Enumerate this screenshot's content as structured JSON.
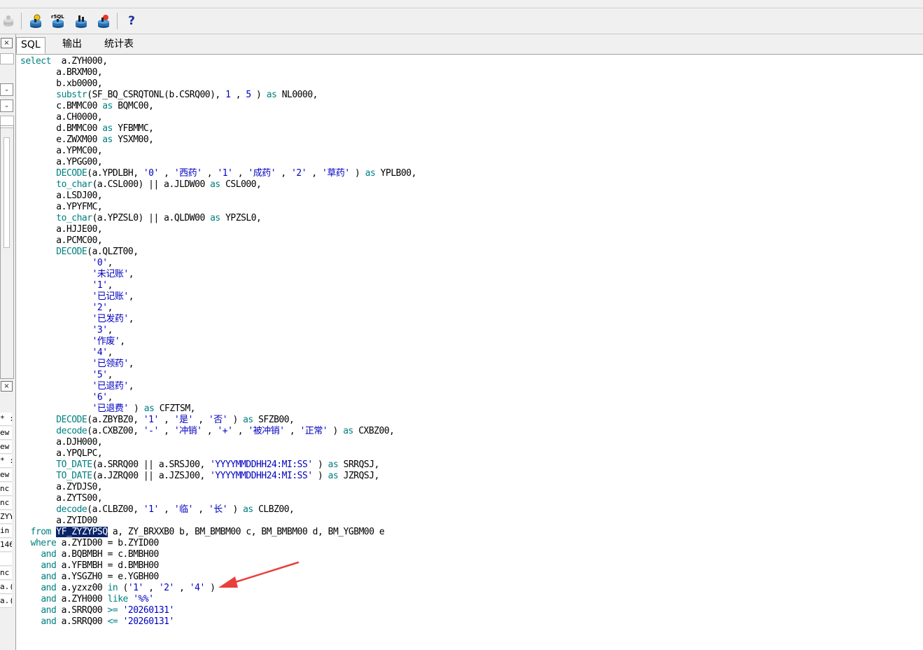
{
  "toolbar": {
    "buttons": [
      "db-disconnect-icon",
      "connect-db-icon",
      "sql-run-icon",
      "db-export-icon",
      "db-commit-icon",
      "help-icon"
    ],
    "help_label": "?"
  },
  "left_pane": {
    "close_label": "×",
    "close2_label": "×",
    "list_items": [
      "* :",
      "ew",
      "ew",
      "* :",
      "ew",
      "nc",
      "nc",
      "ZYY",
      "in",
      "146",
      "",
      "nc",
      "a.(",
      "a.("
    ]
  },
  "tabs": [
    {
      "label": "SQL",
      "active": true
    },
    {
      "label": "输出",
      "active": false
    },
    {
      "label": "统计表",
      "active": false
    }
  ],
  "sql_lines": [
    [
      [
        "kw",
        "select"
      ],
      [
        "",
        "  a.ZYH000,"
      ]
    ],
    [
      [
        "",
        "       a.BRXM00,"
      ]
    ],
    [
      [
        "",
        "       b.xb0000,"
      ]
    ],
    [
      [
        "",
        "       "
      ],
      [
        "fn",
        "substr"
      ],
      [
        "",
        "(SF_BQ_CSRQTONL(b.CSRQ00), "
      ],
      [
        "st",
        "1"
      ],
      [
        "",
        " , "
      ],
      [
        "st",
        "5"
      ],
      [
        "",
        " ) "
      ],
      [
        "kw",
        "as"
      ],
      [
        "",
        " NL0000,"
      ]
    ],
    [
      [
        "",
        "       c.BMMC00 "
      ],
      [
        "kw",
        "as"
      ],
      [
        "",
        " BQMC00,"
      ]
    ],
    [
      [
        "",
        "       a.CH0000,"
      ]
    ],
    [
      [
        "",
        "       d.BMMC00 "
      ],
      [
        "kw",
        "as"
      ],
      [
        "",
        " YFBMMC,"
      ]
    ],
    [
      [
        "",
        "       e.ZWXM00 "
      ],
      [
        "kw",
        "as"
      ],
      [
        "",
        " YSXM00,"
      ]
    ],
    [
      [
        "",
        "       a.YPMC00,"
      ]
    ],
    [
      [
        "",
        "       a.YPGG00,"
      ]
    ],
    [
      [
        "",
        "       "
      ],
      [
        "fn",
        "DECODE"
      ],
      [
        "",
        "(a.YPDLBH, "
      ],
      [
        "st",
        "'0'"
      ],
      [
        "",
        " , "
      ],
      [
        "st",
        "'西药'"
      ],
      [
        "",
        " , "
      ],
      [
        "st",
        "'1'"
      ],
      [
        "",
        " , "
      ],
      [
        "st",
        "'成药'"
      ],
      [
        "",
        " , "
      ],
      [
        "st",
        "'2'"
      ],
      [
        "",
        " , "
      ],
      [
        "st",
        "'草药'"
      ],
      [
        "",
        " ) "
      ],
      [
        "kw",
        "as"
      ],
      [
        "",
        " YPLB00,"
      ]
    ],
    [
      [
        "",
        "       "
      ],
      [
        "fn",
        "to_char"
      ],
      [
        "",
        "(a.CSL000) || a.JLDW00 "
      ],
      [
        "kw",
        "as"
      ],
      [
        "",
        " CSL000,"
      ]
    ],
    [
      [
        "",
        "       a.LSDJ00,"
      ]
    ],
    [
      [
        "",
        "       a.YPYFMC,"
      ]
    ],
    [
      [
        "",
        "       "
      ],
      [
        "fn",
        "to_char"
      ],
      [
        "",
        "(a.YPZSL0) || a.QLDW00 "
      ],
      [
        "kw",
        "as"
      ],
      [
        "",
        " YPZSL0,"
      ]
    ],
    [
      [
        "",
        "       a.HJJE00,"
      ]
    ],
    [
      [
        "",
        "       a.PCMC00,"
      ]
    ],
    [
      [
        "",
        "       "
      ],
      [
        "fn",
        "DECODE"
      ],
      [
        "",
        "(a.QLZT00,"
      ]
    ],
    [
      [
        "",
        "              "
      ],
      [
        "st",
        "'0'"
      ],
      [
        "",
        ","
      ]
    ],
    [
      [
        "",
        "              "
      ],
      [
        "st",
        "'未记账'"
      ],
      [
        "",
        ","
      ]
    ],
    [
      [
        "",
        "              "
      ],
      [
        "st",
        "'1'"
      ],
      [
        "",
        ","
      ]
    ],
    [
      [
        "",
        "              "
      ],
      [
        "st",
        "'已记账'"
      ],
      [
        "",
        ","
      ]
    ],
    [
      [
        "",
        "              "
      ],
      [
        "st",
        "'2'"
      ],
      [
        "",
        ","
      ]
    ],
    [
      [
        "",
        "              "
      ],
      [
        "st",
        "'已发药'"
      ],
      [
        "",
        ","
      ]
    ],
    [
      [
        "",
        "              "
      ],
      [
        "st",
        "'3'"
      ],
      [
        "",
        ","
      ]
    ],
    [
      [
        "",
        "              "
      ],
      [
        "st",
        "'作废'"
      ],
      [
        "",
        ","
      ]
    ],
    [
      [
        "",
        "              "
      ],
      [
        "st",
        "'4'"
      ],
      [
        "",
        ","
      ]
    ],
    [
      [
        "",
        "              "
      ],
      [
        "st",
        "'已领药'"
      ],
      [
        "",
        ","
      ]
    ],
    [
      [
        "",
        "              "
      ],
      [
        "st",
        "'5'"
      ],
      [
        "",
        ","
      ]
    ],
    [
      [
        "",
        "              "
      ],
      [
        "st",
        "'已退药'"
      ],
      [
        "",
        ","
      ]
    ],
    [
      [
        "",
        "              "
      ],
      [
        "st",
        "'6'"
      ],
      [
        "",
        ","
      ]
    ],
    [
      [
        "",
        "              "
      ],
      [
        "st",
        "'已退费'"
      ],
      [
        "",
        " ) "
      ],
      [
        "kw",
        "as"
      ],
      [
        "",
        " CFZTSM,"
      ]
    ],
    [
      [
        "",
        "       "
      ],
      [
        "fn",
        "DECODE"
      ],
      [
        "",
        "(a.ZBYBZ0, "
      ],
      [
        "st",
        "'1'"
      ],
      [
        "",
        " , "
      ],
      [
        "st",
        "'是'"
      ],
      [
        "",
        " , "
      ],
      [
        "st",
        "'否'"
      ],
      [
        "",
        " ) "
      ],
      [
        "kw",
        "as"
      ],
      [
        "",
        " SFZB00,"
      ]
    ],
    [
      [
        "",
        "       "
      ],
      [
        "fn",
        "decode"
      ],
      [
        "",
        "(a.CXBZ00, "
      ],
      [
        "st",
        "'-'"
      ],
      [
        "",
        " , "
      ],
      [
        "st",
        "'冲销'"
      ],
      [
        "",
        " , "
      ],
      [
        "st",
        "'+'"
      ],
      [
        "",
        " , "
      ],
      [
        "st",
        "'被冲销'"
      ],
      [
        "",
        " , "
      ],
      [
        "st",
        "'正常'"
      ],
      [
        "",
        " ) "
      ],
      [
        "kw",
        "as"
      ],
      [
        "",
        " CXBZ00,"
      ]
    ],
    [
      [
        "",
        "       a.DJH000,"
      ]
    ],
    [
      [
        "",
        "       a.YPQLPC,"
      ]
    ],
    [
      [
        "",
        "       "
      ],
      [
        "fn",
        "TO_DATE"
      ],
      [
        "",
        "(a.SRRQ00 || a.SRSJ00, "
      ],
      [
        "st",
        "'YYYYMMDDHH24:MI:SS'"
      ],
      [
        "",
        " ) "
      ],
      [
        "kw",
        "as"
      ],
      [
        "",
        " SRRQSJ,"
      ]
    ],
    [
      [
        "",
        "       "
      ],
      [
        "fn",
        "TO_DATE"
      ],
      [
        "",
        "(a.JZRQ00 || a.JZSJ00, "
      ],
      [
        "st",
        "'YYYYMMDDHH24:MI:SS'"
      ],
      [
        "",
        " ) "
      ],
      [
        "kw",
        "as"
      ],
      [
        "",
        " JZRQSJ,"
      ]
    ],
    [
      [
        "",
        "       a.ZYDJS0,"
      ]
    ],
    [
      [
        "",
        "       a.ZYTS00,"
      ]
    ],
    [
      [
        "",
        "       "
      ],
      [
        "fn",
        "decode"
      ],
      [
        "",
        "(a.CLBZ00, "
      ],
      [
        "st",
        "'1'"
      ],
      [
        "",
        " , "
      ],
      [
        "st",
        "'临'"
      ],
      [
        "",
        " , "
      ],
      [
        "st",
        "'长'"
      ],
      [
        "",
        " ) "
      ],
      [
        "kw",
        "as"
      ],
      [
        "",
        " CLBZ00,"
      ]
    ],
    [
      [
        "",
        "       a.ZYID00"
      ]
    ],
    [
      [
        "",
        "  "
      ],
      [
        "kw",
        "from"
      ],
      [
        "",
        " "
      ],
      [
        "sel",
        "YF_ZYZYPSQ"
      ],
      [
        "",
        " a, ZY_BRXXB0 b, BM_BMBM00 c, BM_BMBM00 d, BM_YGBM00 e"
      ]
    ],
    [
      [
        "",
        "  "
      ],
      [
        "kw",
        "where"
      ],
      [
        "",
        " a.ZYID00 = b.ZYID00"
      ]
    ],
    [
      [
        "",
        "    "
      ],
      [
        "kw",
        "and"
      ],
      [
        "",
        " a.BQBMBH = c.BMBH00"
      ]
    ],
    [
      [
        "",
        "    "
      ],
      [
        "kw",
        "and"
      ],
      [
        "",
        " a.YFBMBH = d.BMBH00"
      ]
    ],
    [
      [
        "",
        "    "
      ],
      [
        "kw",
        "and"
      ],
      [
        "",
        " a.YSGZH0 = e.YGBH00"
      ]
    ],
    [
      [
        "",
        "    "
      ],
      [
        "kw",
        "and"
      ],
      [
        "",
        " a.yzxz00 "
      ],
      [
        "kw",
        "in"
      ],
      [
        "",
        " ("
      ],
      [
        "st",
        "'1'"
      ],
      [
        "",
        " , "
      ],
      [
        "st",
        "'2'"
      ],
      [
        "",
        " , "
      ],
      [
        "st",
        "'4'"
      ],
      [
        "",
        " )"
      ]
    ],
    [
      [
        "",
        "    "
      ],
      [
        "kw",
        "and"
      ],
      [
        "",
        " a.ZYH000 "
      ],
      [
        "kw",
        "like"
      ],
      [
        "",
        " "
      ],
      [
        "st",
        "'%%'"
      ]
    ],
    [
      [
        "",
        "    "
      ],
      [
        "kw",
        "and"
      ],
      [
        "",
        " a.SRRQ00 "
      ],
      [
        "kw",
        ">="
      ],
      [
        "",
        " "
      ],
      [
        "st",
        "'20260131'"
      ]
    ],
    [
      [
        "",
        "    "
      ],
      [
        "kw",
        "and"
      ],
      [
        "",
        " a.SRRQ00 "
      ],
      [
        "kw",
        "<="
      ],
      [
        "",
        " "
      ],
      [
        "st",
        "'20260131'"
      ]
    ]
  ],
  "colors": {
    "keyword": "#008080",
    "string": "#0000c0",
    "selection": "#0a246a",
    "arrow": "#e8403a"
  }
}
